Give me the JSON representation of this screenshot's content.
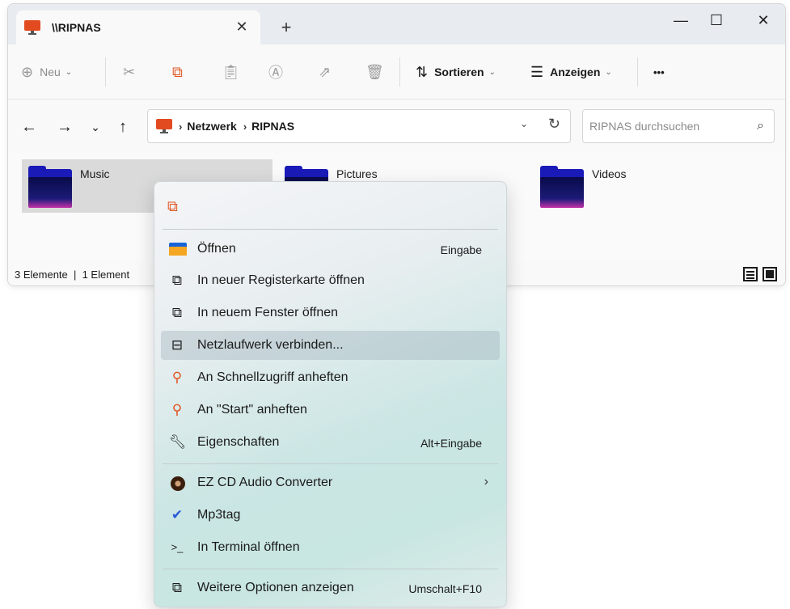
{
  "window": {
    "tab_title": "\\\\RIPNAS",
    "tab_close": "✕",
    "new_tab": "+",
    "minimize": "—",
    "maximize": "☐",
    "close": "✕"
  },
  "toolbar": {
    "new_label": "Neu",
    "sort_label": "Sortieren",
    "view_label": "Anzeigen",
    "more": "•••"
  },
  "address": {
    "crumbs": [
      "Netzwerk",
      "RIPNAS"
    ],
    "search_placeholder": "RIPNAS durchsuchen"
  },
  "folders": [
    {
      "name": "Music"
    },
    {
      "name": "Pictures"
    },
    {
      "name": "Videos"
    }
  ],
  "status": {
    "text": "3 Elemente  |  1 Element"
  },
  "context_menu": {
    "items": [
      {
        "label": "Öffnen",
        "shortcut": "Eingabe",
        "icon": "folder-open-icon"
      },
      {
        "label": "In neuer Registerkarte öffnen",
        "shortcut": "",
        "icon": "new-tab-icon"
      },
      {
        "label": "In neuem Fenster öffnen",
        "shortcut": "",
        "icon": "new-window-icon"
      },
      {
        "label": "Netzlaufwerk verbinden...",
        "shortcut": "",
        "icon": "network-drive-icon"
      },
      {
        "label": "An Schnellzugriff anheften",
        "shortcut": "",
        "icon": "pin-icon"
      },
      {
        "label": "An \"Start\" anheften",
        "shortcut": "",
        "icon": "pin-icon"
      },
      {
        "label": "Eigenschaften",
        "shortcut": "Alt+Eingabe",
        "icon": "wrench-icon"
      },
      {
        "label": "EZ CD Audio Converter",
        "shortcut": "",
        "icon": "disc-icon"
      },
      {
        "label": "Mp3tag",
        "shortcut": "",
        "icon": "mp3tag-icon"
      },
      {
        "label": "In Terminal öffnen",
        "shortcut": "",
        "icon": "terminal-icon"
      },
      {
        "label": "Weitere Optionen anzeigen",
        "shortcut": "Umschalt+F10",
        "icon": "more-options-icon"
      }
    ],
    "submenu_arrow": "›"
  },
  "colors": {
    "accent": "#1665d8",
    "pin": "#e0541f",
    "folder": "#1a1ab8"
  }
}
